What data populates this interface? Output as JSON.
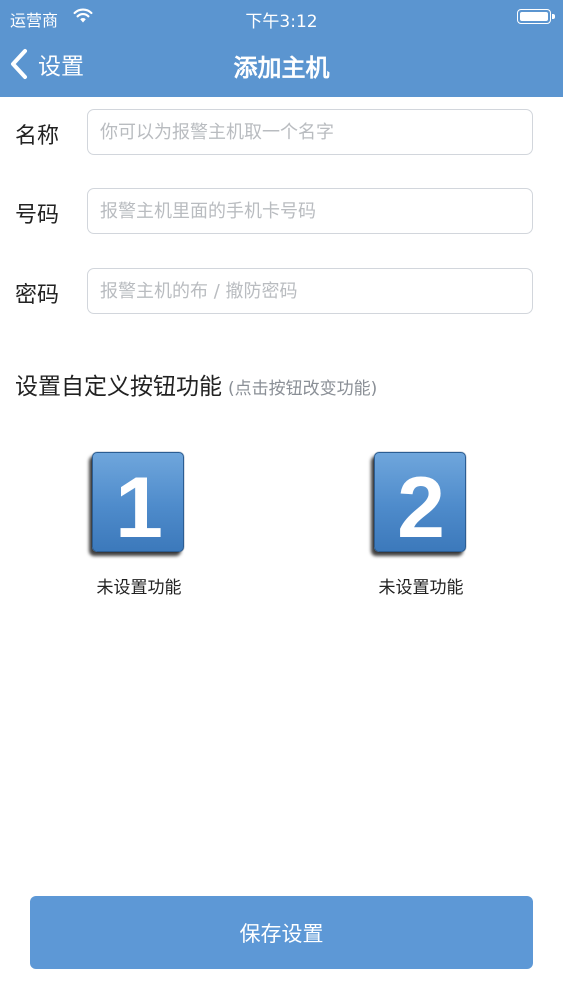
{
  "status_bar": {
    "carrier": "运营商",
    "time": "下午3:12"
  },
  "nav": {
    "back_label": "设置",
    "title": "添加主机"
  },
  "form": {
    "name_label": "名称",
    "name_placeholder": "你可以为报警主机取一个名字",
    "number_label": "号码",
    "number_placeholder": "报警主机里面的手机卡号码",
    "password_label": "密码",
    "password_placeholder": "报警主机的布 / 撤防密码"
  },
  "custom_buttons": {
    "title": "设置自定义按钮功能",
    "hint": "(点击按钮改变功能)",
    "buttons": [
      {
        "number": "1",
        "caption": "未设置功能"
      },
      {
        "number": "2",
        "caption": "未设置功能"
      }
    ]
  },
  "save_label": "保存设置",
  "colors": {
    "accent": "#5b95d0",
    "save_button": "#5d98d6",
    "tile_blue": "#4e8bcb"
  },
  "icons": [
    "wifi-icon",
    "battery-icon",
    "back-chevron-icon"
  ]
}
